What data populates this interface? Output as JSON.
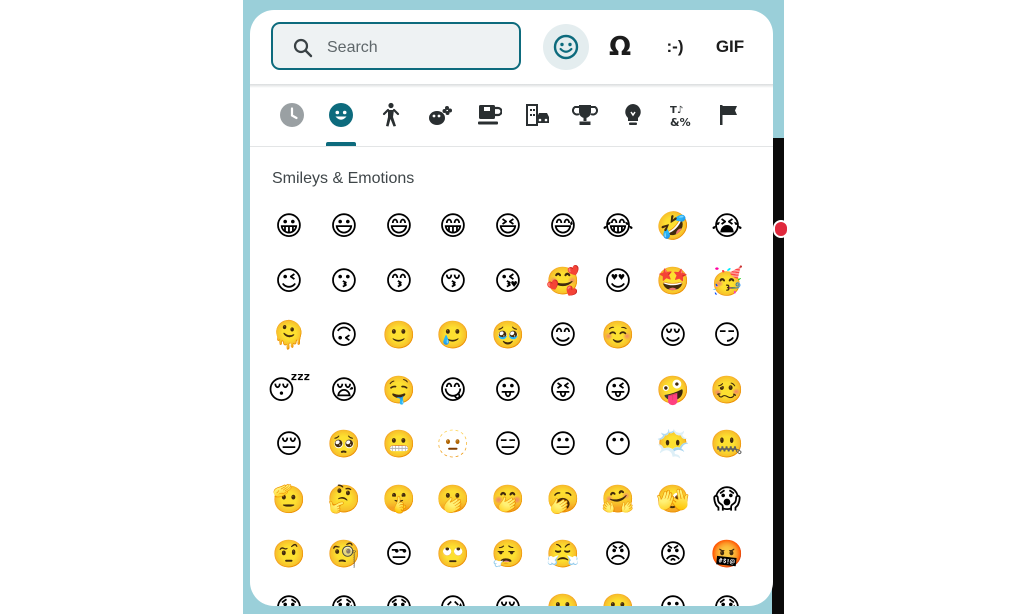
{
  "search": {
    "placeholder": "Search",
    "value": ""
  },
  "modes": [
    {
      "name": "emoji",
      "label": "",
      "active": true
    },
    {
      "name": "symbols",
      "label": "Ω"
    },
    {
      "name": "emoticons",
      "label": ":-)"
    },
    {
      "name": "gif",
      "label": "GIF"
    }
  ],
  "categories": [
    "recent",
    "smileys-emotions",
    "people",
    "animals-nature",
    "food-drink",
    "travel-places",
    "activities",
    "objects",
    "symbols",
    "flags"
  ],
  "colors": {
    "accent": "#0d6b7d",
    "backdrop": "#9acfd9"
  },
  "section": {
    "title": "Smileys & Emotions"
  },
  "emoji_rows": [
    [
      "😀",
      "😃",
      "😄",
      "😁",
      "😆",
      "😅",
      "😂",
      "🤣",
      "😭"
    ],
    [
      "😉",
      "😗",
      "😙",
      "😚",
      "😘",
      "🥰",
      "😍",
      "🤩",
      "🥳"
    ],
    [
      "🫠",
      "🙃",
      "🙂",
      "🥲",
      "🥹",
      "😊",
      "☺️",
      "😌",
      "😏"
    ],
    [
      "😴",
      "😪",
      "🤤",
      "😋",
      "😛",
      "😝",
      "😜",
      "🤪",
      "🥴"
    ],
    [
      "😔",
      "🥺",
      "😬",
      "🫥",
      "😑",
      "😐",
      "😶",
      "😶‍🌫️",
      "🤐"
    ],
    [
      "🫡",
      "🤔",
      "🤫",
      "🫢",
      "🤭",
      "🥱",
      "🤗",
      "🫣",
      "😱"
    ],
    [
      "🤨",
      "🧐",
      "😒",
      "🙄",
      "😮‍💨",
      "😤",
      "😠",
      "😡",
      "🤬"
    ],
    [
      "😞",
      "😓",
      "😟",
      "😥",
      "😢",
      "☹️",
      "🙁",
      "😕",
      "😰"
    ]
  ]
}
